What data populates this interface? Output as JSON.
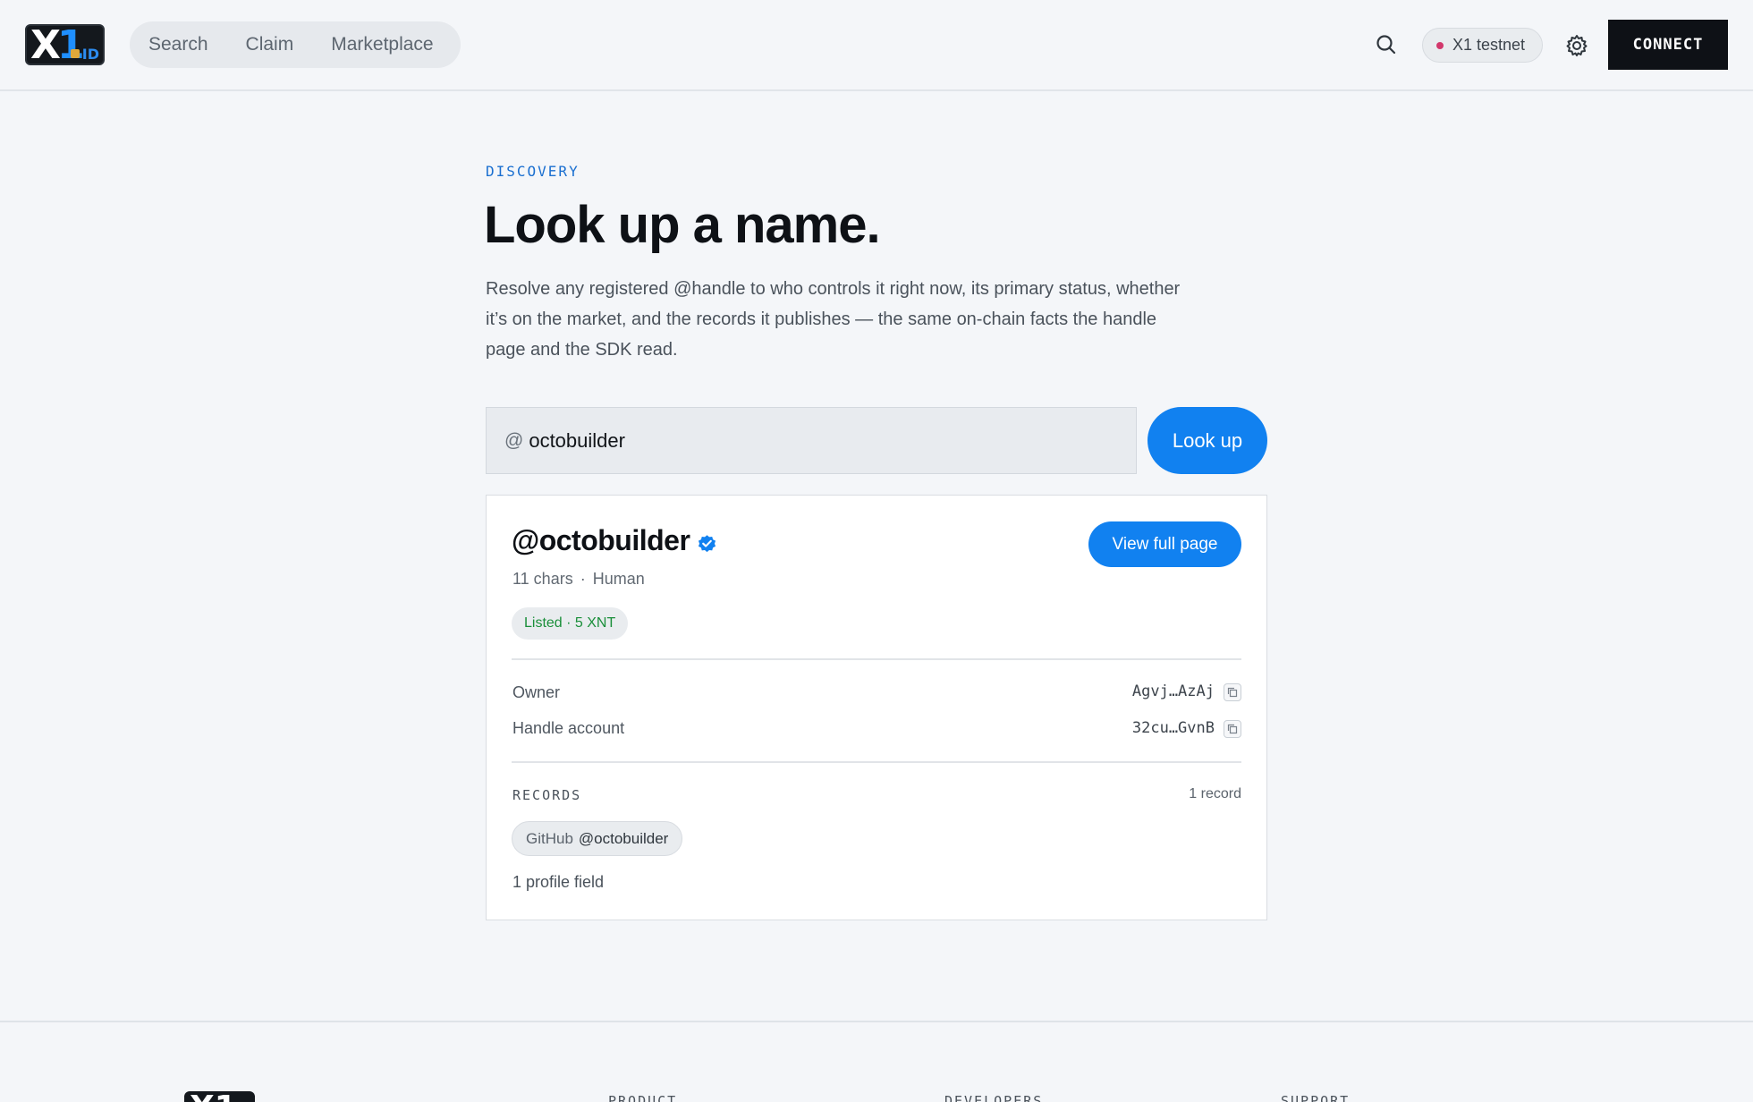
{
  "header": {
    "logo_text": "X1",
    "logo_suffix": "ID",
    "nav": [
      {
        "label": "Search"
      },
      {
        "label": "Claim"
      },
      {
        "label": "Marketplace"
      }
    ],
    "network_label": "X1 testnet",
    "network_dot_color": "#d2386c",
    "connect_label": "CONNECT"
  },
  "hero": {
    "eyebrow": "DISCOVERY",
    "title": "Look up a name.",
    "description": "Resolve any registered @handle to who controls it right now, its primary status, whether it’s on the market, and the records it publishes — the same on-chain facts the handle page and the SDK read."
  },
  "lookup": {
    "prefix": "@",
    "value": "octobuilder",
    "button_label": "Look up"
  },
  "result": {
    "handle": "@octobuilder",
    "verified_icon": "verified-check-icon",
    "chars": "11 chars",
    "separator": "·",
    "kind": "Human",
    "view_button_label": "View full page",
    "listing_badge": "Listed · 5 XNT",
    "owner_label": "Owner",
    "owner_value": "Agvj…AzAj",
    "handle_account_label": "Handle account",
    "handle_account_value": "32cu…GvnB",
    "records_title": "RECORDS",
    "records_count": "1 record",
    "records": [
      {
        "platform": "GitHub",
        "value": "@octobuilder"
      }
    ],
    "profile_fields": "1 profile field"
  },
  "footer": {
    "columns": [
      "PRODUCT",
      "DEVELOPERS",
      "SUPPORT"
    ]
  },
  "colors": {
    "accent": "#1181f0",
    "listed_green": "#1a8f3a",
    "eyebrow_blue": "#1a6fd0"
  }
}
